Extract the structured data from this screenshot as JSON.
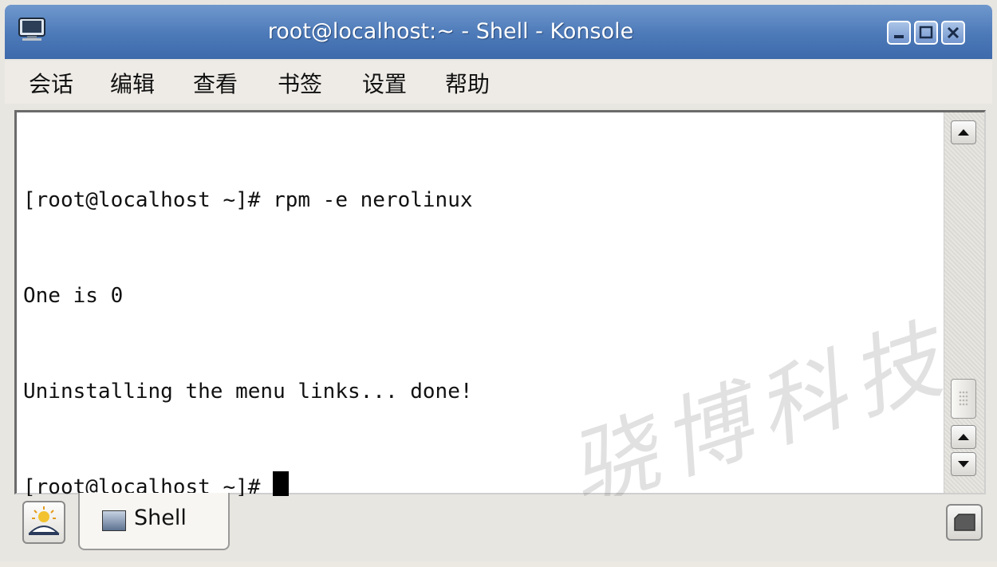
{
  "window": {
    "title": "root@localhost:~ - Shell - Konsole"
  },
  "menubar": {
    "items": [
      "会话",
      "编辑",
      "查看",
      "书签",
      "设置",
      "帮助"
    ]
  },
  "terminal": {
    "lines": [
      "[root@localhost ~]# rpm -e nerolinux",
      "One is 0",
      "Uninstalling the menu links... done!",
      "[root@localhost ~]# "
    ]
  },
  "tabs": [
    {
      "label": "Shell",
      "icon": "terminal-icon"
    }
  ],
  "watermark": "骁博科技",
  "colors": {
    "titlebar": "#4c79b8",
    "background": "#e8e6e1",
    "terminal_bg": "#ffffff"
  }
}
